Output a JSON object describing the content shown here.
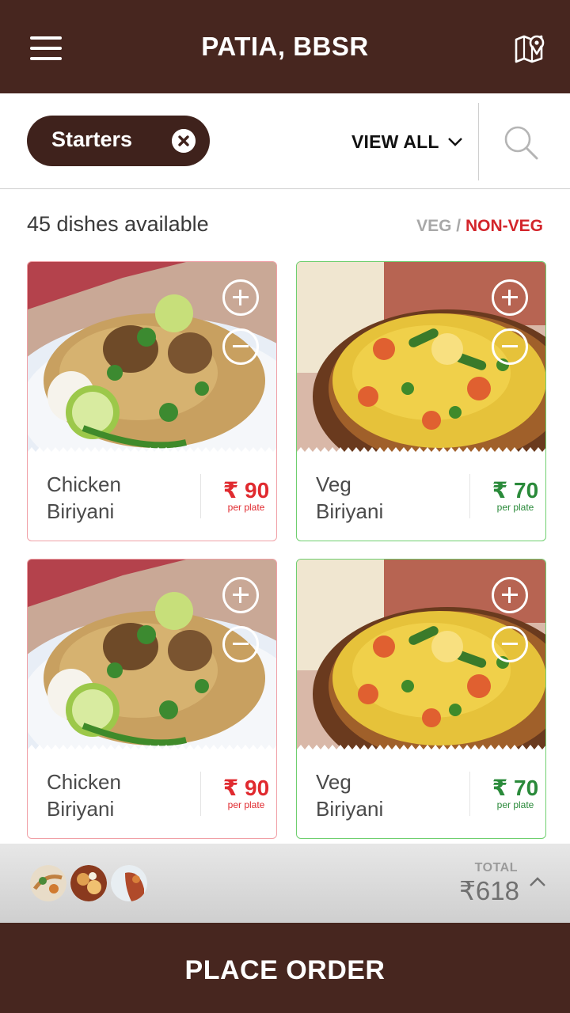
{
  "header": {
    "title": "PATIA, BBSR",
    "menu_icon": "hamburger-icon",
    "map_icon": "map-pin-icon"
  },
  "filters": {
    "chip_label": "Starters",
    "view_all_label": "VIEW ALL",
    "search_icon": "search-icon"
  },
  "info": {
    "dish_count": "45 dishes available",
    "veg_label": "VEG",
    "separator": "/",
    "nonveg_label": "NON-VEG"
  },
  "colors": {
    "brand": "#47261f",
    "nonveg": "#e02a2f",
    "veg": "#2a8a3a"
  },
  "dishes": [
    {
      "name_line1": "Chicken",
      "name_line2": "Biriyani",
      "price": "₹ 90",
      "unit": "per plate",
      "type": "non-veg"
    },
    {
      "name_line1": "Veg",
      "name_line2": "Biriyani",
      "price": "₹ 70",
      "unit": "per plate",
      "type": "veg"
    },
    {
      "name_line1": "Chicken",
      "name_line2": "Biriyani",
      "price": "₹ 90",
      "unit": "per plate",
      "type": "non-veg"
    },
    {
      "name_line1": "Veg",
      "name_line2": "Biriyani",
      "price": "₹ 70",
      "unit": "per plate",
      "type": "veg"
    }
  ],
  "cart": {
    "total_label": "TOTAL",
    "total_value": "₹618"
  },
  "footer": {
    "place_order_label": "PLACE ORDER"
  }
}
